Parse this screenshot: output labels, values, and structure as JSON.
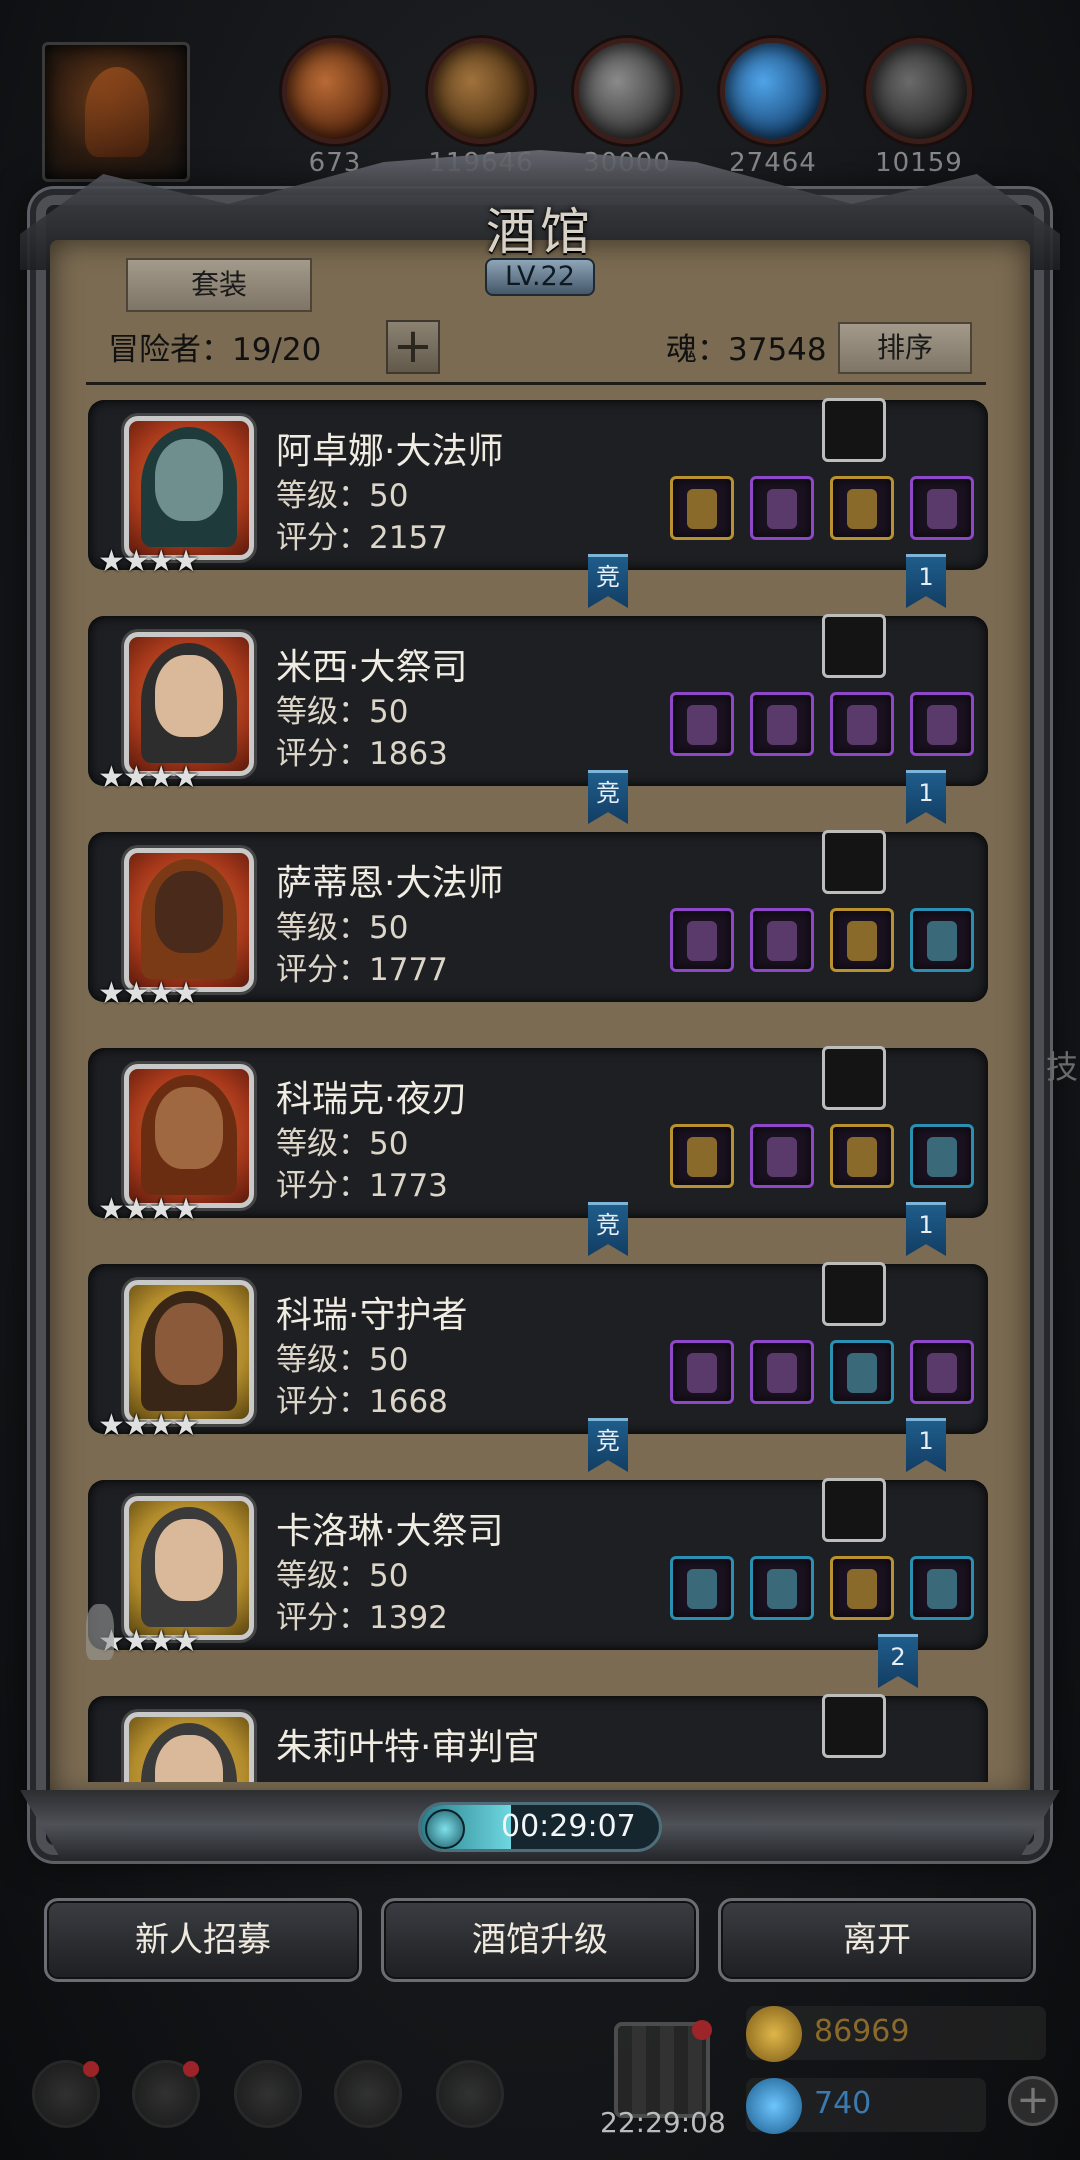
{
  "resources": [
    {
      "name": "meat",
      "value": "673",
      "color": "#9b4a1d"
    },
    {
      "name": "wood",
      "value": "119646",
      "color": "#8b5a2b"
    },
    {
      "name": "iron",
      "value": "30000",
      "color": "#6e6e6e"
    },
    {
      "name": "crystal",
      "value": "27464",
      "color": "#2a6fb0"
    },
    {
      "name": "stone",
      "value": "10159",
      "color": "#555555"
    }
  ],
  "tavern": {
    "title": "酒馆",
    "level": "LV.22",
    "suit_label": "套装",
    "adventurers": "冒险者：19/20",
    "add_label": "+",
    "soul": "魂：37548",
    "sort_label": "排序"
  },
  "heroes": [
    {
      "name": "阿卓娜·大法师",
      "level": "等级：50",
      "score": "评分：2157",
      "stars": "★★★★",
      "frame": "red",
      "skin": "#6f8f8f",
      "hood": "#1e3a3b",
      "slots": [
        "gold",
        "purple",
        "gold",
        "purple"
      ],
      "ribbon_left": "竞",
      "ribbon_right": "1"
    },
    {
      "name": "米西·大祭司",
      "level": "等级：50",
      "score": "评分：1863",
      "stars": "★★★★",
      "frame": "red",
      "skin": "#d9b99a",
      "hood": "#2d2d2d",
      "slots": [
        "purple",
        "purple",
        "purple",
        "purple"
      ],
      "ribbon_left": "竞",
      "ribbon_right": "1"
    },
    {
      "name": "萨蒂恩·大法师",
      "level": "等级：50",
      "score": "评分：1777",
      "stars": "★★★★",
      "frame": "red",
      "skin": "#4a2a1a",
      "hood": "#7a3a16",
      "slots": [
        "purple",
        "purple",
        "gold",
        "cyan"
      ],
      "ribbon_left": "",
      "ribbon_right": ""
    },
    {
      "name": "科瑞克·夜刃",
      "level": "等级：50",
      "score": "评分：1773",
      "stars": "★★★★",
      "frame": "red",
      "skin": "#a06840",
      "hood": "#6a2d12",
      "slots": [
        "gold",
        "purple",
        "gold",
        "cyan"
      ],
      "ribbon_left": "竞",
      "ribbon_right": "1"
    },
    {
      "name": "科瑞·守护者",
      "level": "等级：50",
      "score": "评分：1668",
      "stars": "★★★★",
      "frame": "gold",
      "skin": "#8a5a3a",
      "hood": "#3a2616",
      "slots": [
        "purple",
        "purple",
        "cyan",
        "purple"
      ],
      "ribbon_left": "竞",
      "ribbon_right": "1"
    },
    {
      "name": "卡洛琳·大祭司",
      "level": "等级：50",
      "score": "评分：1392",
      "stars": "★★★★",
      "frame": "gold",
      "skin": "#d9b99a",
      "hood": "#3a3a3a",
      "slots": [
        "cyan",
        "cyan",
        "gold",
        "cyan"
      ],
      "ribbon_left": "",
      "ribbon_right": "2"
    },
    {
      "name": "朱莉叶特·审判官",
      "level": "",
      "score": "",
      "stars": "",
      "frame": "gold",
      "skin": "#d9b99a",
      "hood": "#3a3a3a",
      "slots": [],
      "ribbon_left": "",
      "ribbon_right": ""
    }
  ],
  "timer": {
    "label": "00:29:07",
    "progress": 0.38
  },
  "buttons": {
    "recruit": "新人招募",
    "upgrade": "酒馆升级",
    "leave": "离开"
  },
  "bottom": {
    "gift_time": "22:29:08",
    "gold": "86969",
    "gem": "740"
  },
  "side_text": "技",
  "colors": {
    "panel": "#7b6b52",
    "card": "#1d1f23",
    "ribbon": "#1f5d8b"
  }
}
